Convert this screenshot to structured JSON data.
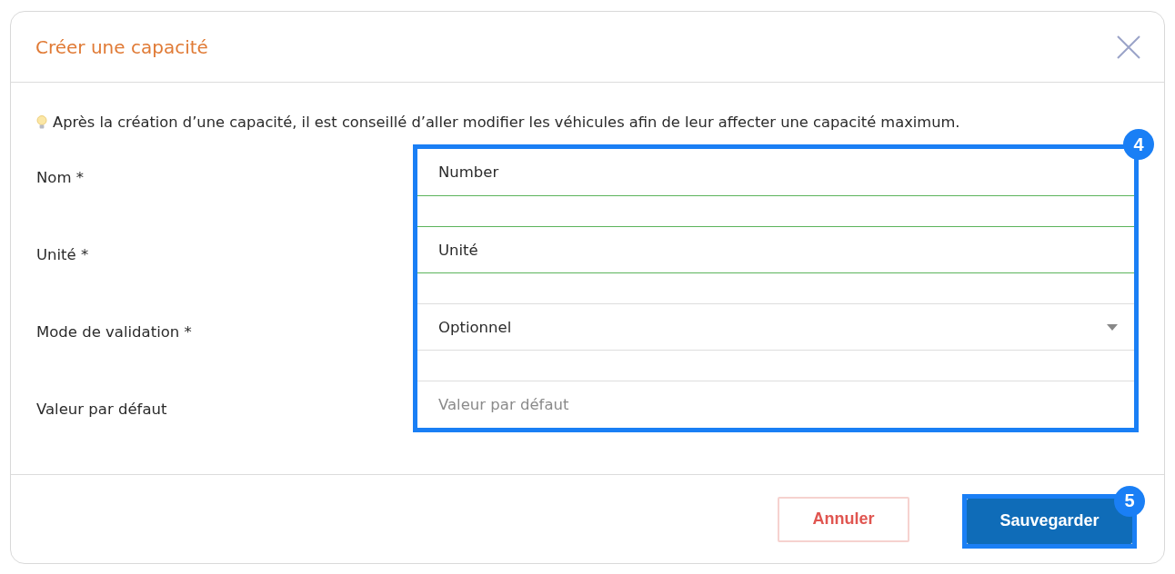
{
  "dialog": {
    "title": "Créer une capacité"
  },
  "tip": "Après la création d’une capacité, il est conseillé d’aller modifier les véhicules afin de leur affecter une capacité maximum.",
  "form": {
    "callout": "4",
    "fields": [
      {
        "label": "Nom *",
        "kind": "text",
        "value": "Number",
        "valid": true
      },
      {
        "label": "Unité *",
        "kind": "text",
        "value": "Unité",
        "valid": true
      },
      {
        "label": "Mode de validation *",
        "kind": "select",
        "value": "Optionnel",
        "valid": false
      },
      {
        "label": "Valeur par défaut",
        "kind": "text",
        "placeholder": "Valeur par défaut",
        "valid": false
      }
    ]
  },
  "buttons": [
    {
      "label": "Annuler",
      "kind": "secondary"
    },
    {
      "label": "Sauvegarder",
      "kind": "primary",
      "callout": "5"
    }
  ]
}
